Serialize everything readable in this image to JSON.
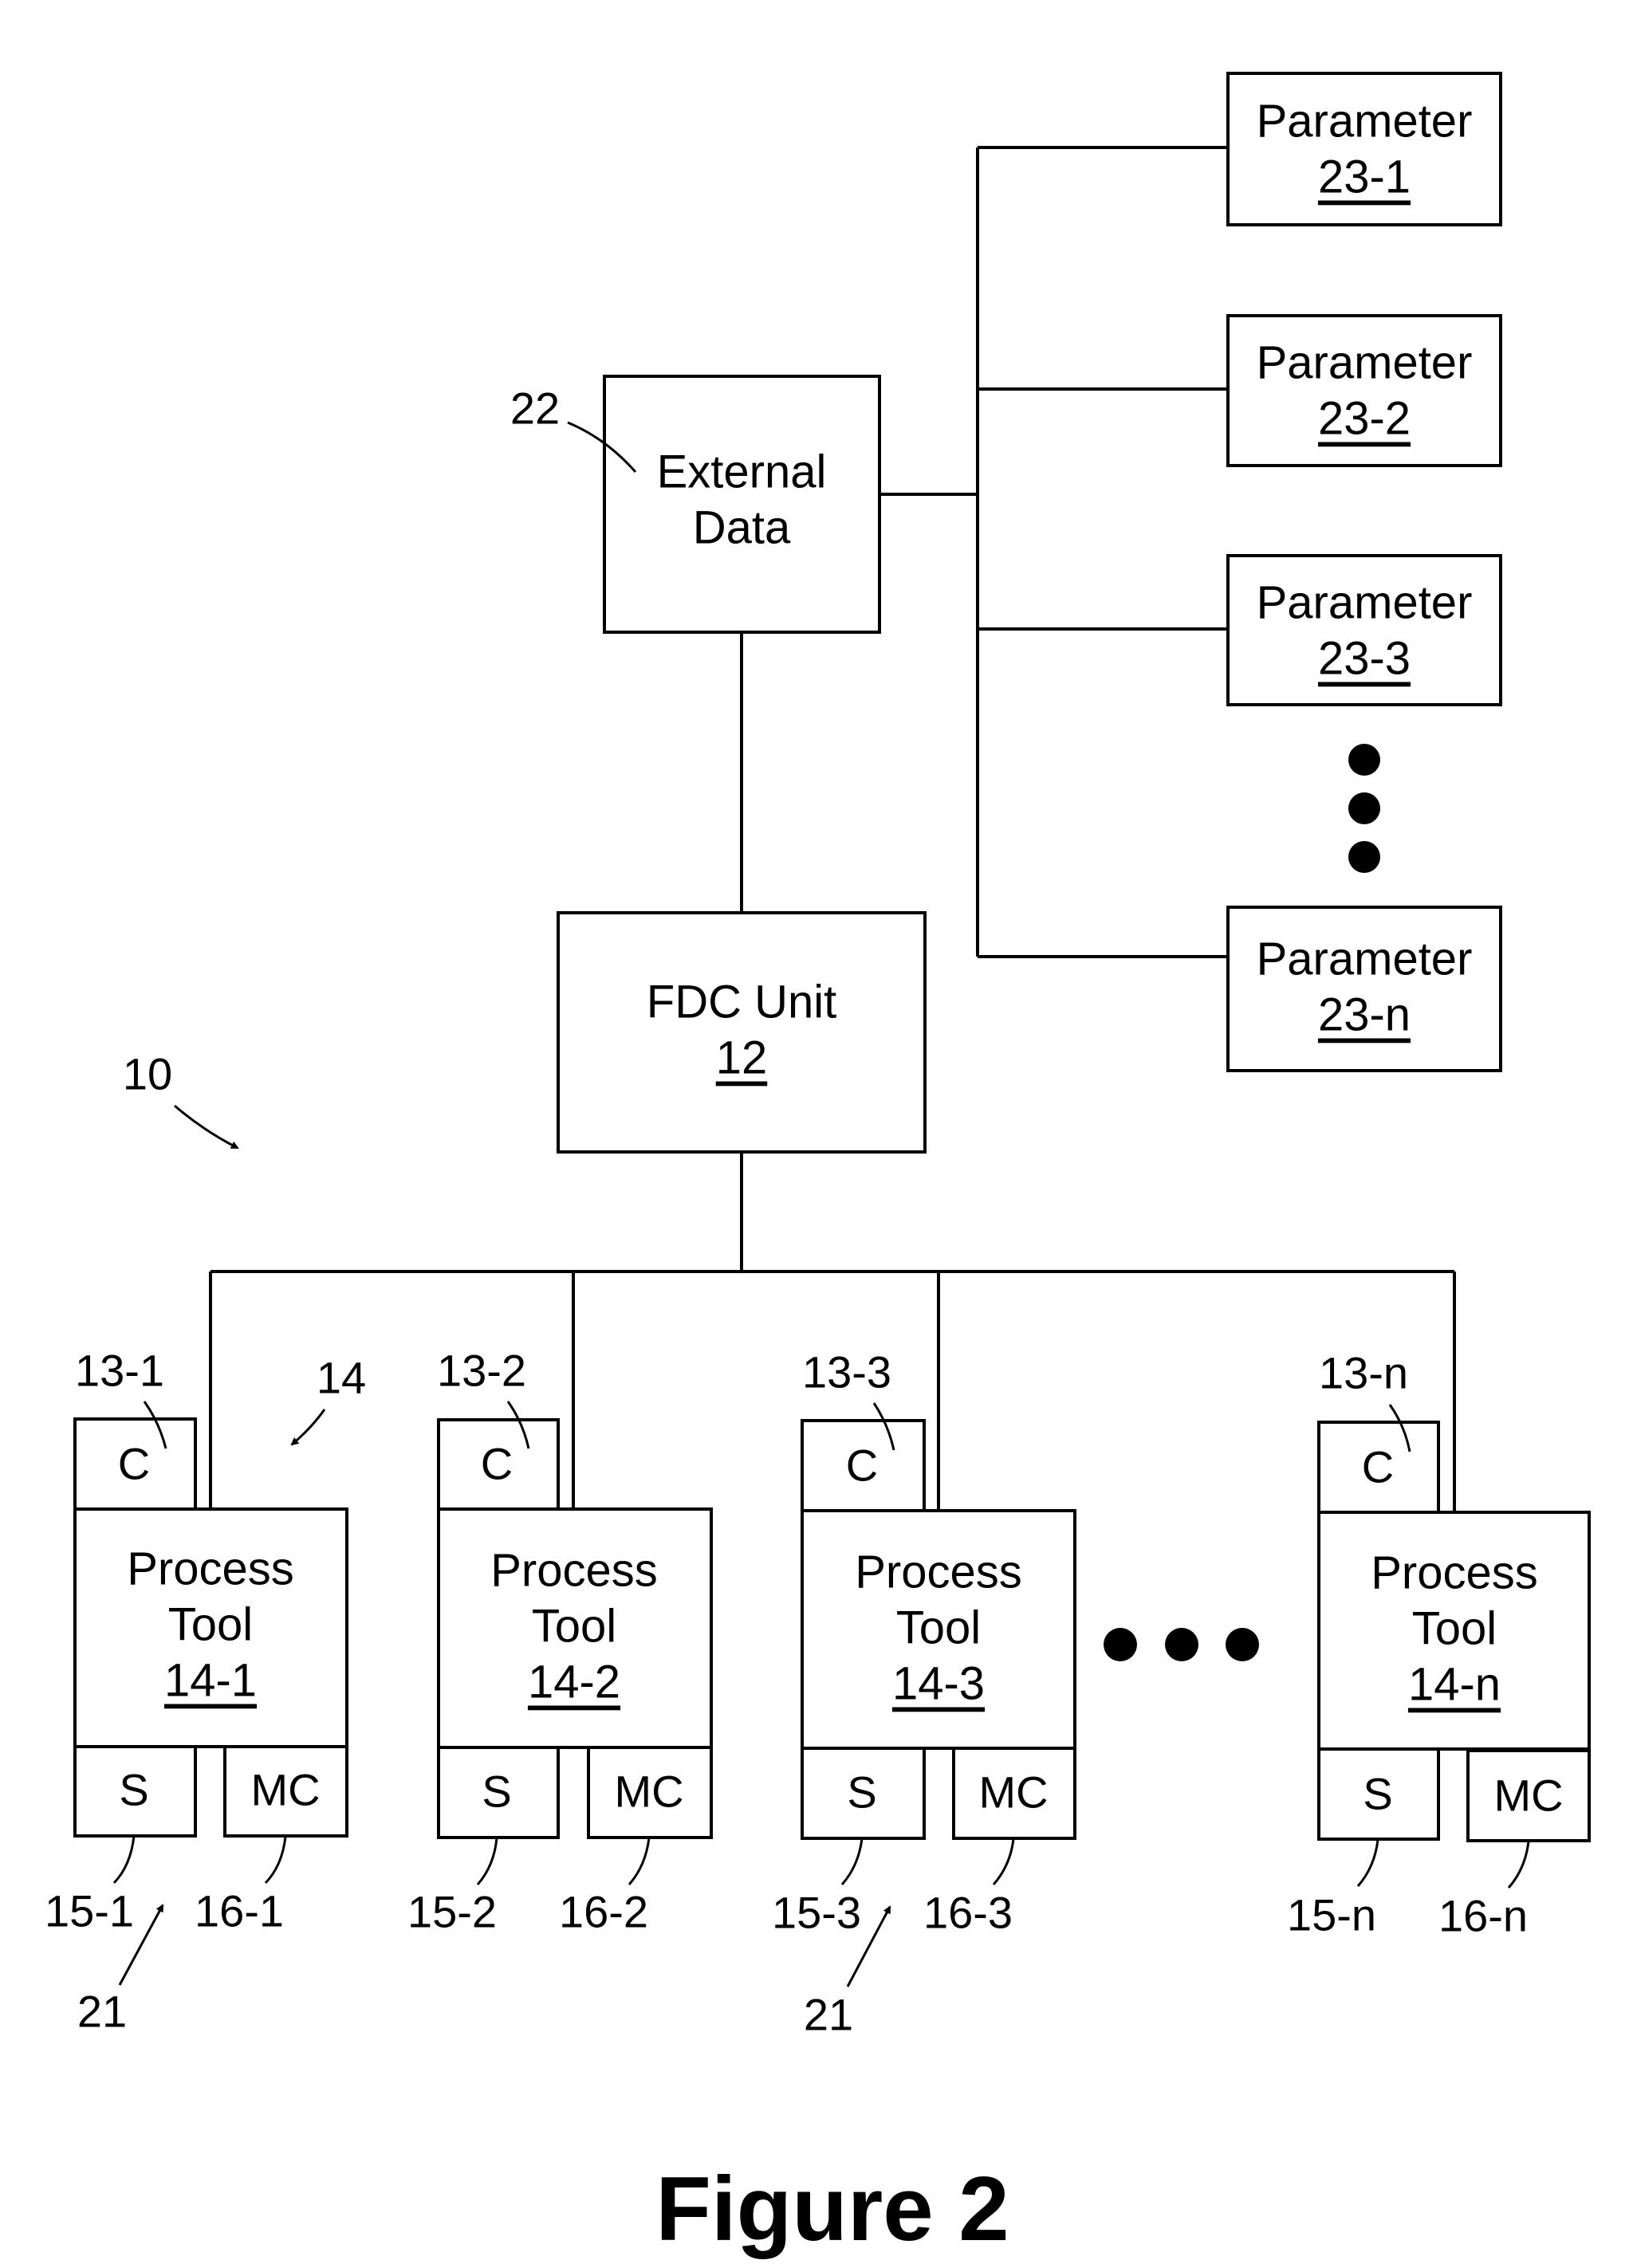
{
  "figure": {
    "caption": "Figure 2",
    "system_ref": "10",
    "tools_group_ref": "14",
    "external_data": {
      "line1": "External",
      "line2": "Data",
      "ref": "22"
    },
    "fdc_unit": {
      "line1": "FDC Unit",
      "ref": "12"
    },
    "parameters": [
      {
        "label": "Parameter",
        "ref": "23-1"
      },
      {
        "label": "Parameter",
        "ref": "23-2"
      },
      {
        "label": "Parameter",
        "ref": "23-3"
      },
      {
        "label": "Parameter",
        "ref": "23-n"
      }
    ],
    "tools": [
      {
        "line1": "Process",
        "line2": "Tool",
        "ref": "14-1",
        "c_label": "C",
        "c_ref": "13-1",
        "s_label": "S",
        "s_ref": "15-1",
        "mc_label": "MC",
        "mc_ref": "16-1",
        "sensor_group_ref": "21"
      },
      {
        "line1": "Process",
        "line2": "Tool",
        "ref": "14-2",
        "c_label": "C",
        "c_ref": "13-2",
        "s_label": "S",
        "s_ref": "15-2",
        "mc_label": "MC",
        "mc_ref": "16-2"
      },
      {
        "line1": "Process",
        "line2": "Tool",
        "ref": "14-3",
        "c_label": "C",
        "c_ref": "13-3",
        "s_label": "S",
        "s_ref": "15-3",
        "mc_label": "MC",
        "mc_ref": "16-3",
        "sensor_group_ref": "21"
      },
      {
        "line1": "Process",
        "line2": "Tool",
        "ref": "14-n",
        "c_label": "C",
        "c_ref": "13-n",
        "s_label": "S",
        "s_ref": "15-n",
        "mc_label": "MC",
        "mc_ref": "16-n"
      }
    ],
    "ellipsis_icons": [
      "vertical-ellipsis",
      "horizontal-ellipsis"
    ]
  }
}
